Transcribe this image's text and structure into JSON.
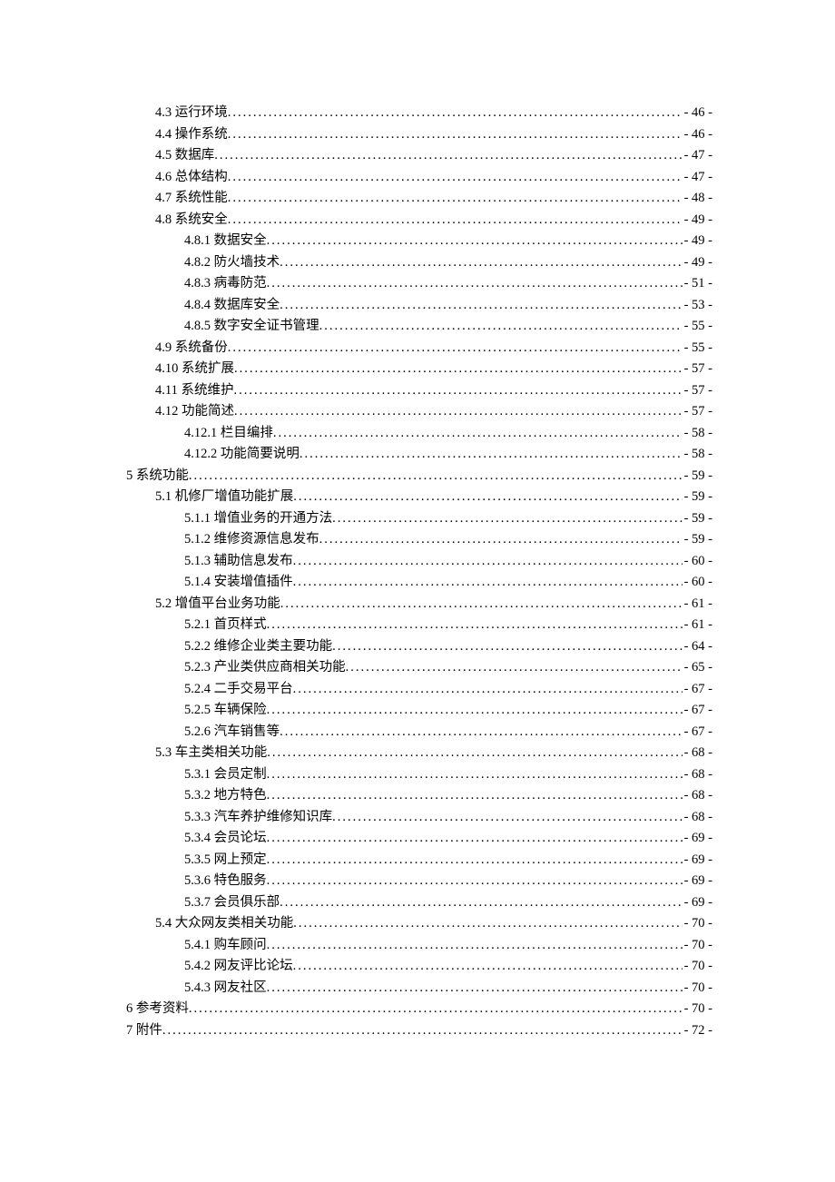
{
  "toc": [
    {
      "level": 1,
      "label": "4.3 运行环境",
      "page": "- 46 -"
    },
    {
      "level": 1,
      "label": "4.4 操作系统",
      "page": "- 46 -"
    },
    {
      "level": 1,
      "label": "4.5 数据库",
      "page": "- 47 -"
    },
    {
      "level": 1,
      "label": "4.6 总体结构",
      "page": "- 47 -"
    },
    {
      "level": 1,
      "label": "4.7  系统性能",
      "page": "- 48 -"
    },
    {
      "level": 1,
      "label": "4.8  系统安全",
      "page": "- 49 -"
    },
    {
      "level": 2,
      "label": "4.8.1  数据安全",
      "page": "- 49 -"
    },
    {
      "level": 2,
      "label": "4.8.2  防火墙技术",
      "page": "- 49 -"
    },
    {
      "level": 2,
      "label": "4.8.3  病毒防范",
      "page": "- 51 -"
    },
    {
      "level": 2,
      "label": "4.8.4  数据库安全",
      "page": "- 53 -"
    },
    {
      "level": 2,
      "label": "4.8.5 数字安全证书管理",
      "page": "- 55 -"
    },
    {
      "level": 1,
      "label": "4.9  系统备份",
      "page": "- 55 -"
    },
    {
      "level": 1,
      "label": "4.10  系统扩展",
      "page": "- 57 -"
    },
    {
      "level": 1,
      "label": "4.11  系统维护",
      "page": "- 57 -"
    },
    {
      "level": 1,
      "label": "4.12 功能简述",
      "page": "- 57 -"
    },
    {
      "level": 2,
      "label": "4.12.1 栏目编排",
      "page": "- 58 -"
    },
    {
      "level": 2,
      "label": "4.12.2 功能简要说明",
      "page": "- 58 -"
    },
    {
      "level": 0,
      "label": "5 系统功能",
      "page": "- 59 -"
    },
    {
      "level": 1,
      "label": "5.1 机修厂增值功能扩展",
      "page": "- 59 -"
    },
    {
      "level": 2,
      "label": "5.1.1 增值业务的开通方法",
      "page": "- 59 -"
    },
    {
      "level": 2,
      "label": "5.1.2 维修资源信息发布",
      "page": "- 59 -"
    },
    {
      "level": 2,
      "label": "5.1.3 辅助信息发布",
      "page": "- 60 -"
    },
    {
      "level": 2,
      "label": "5.1.4 安装增值插件",
      "page": "- 60 -"
    },
    {
      "level": 1,
      "label": "5.2 增值平台业务功能",
      "page": "- 61 -"
    },
    {
      "level": 2,
      "label": "5.2.1 首页样式",
      "page": "- 61 -"
    },
    {
      "level": 2,
      "label": "5.2.2 维修企业类主要功能",
      "page": "- 64 -"
    },
    {
      "level": 2,
      "label": "5.2.3 产业类供应商相关功能",
      "page": "- 65 -"
    },
    {
      "level": 2,
      "label": "5.2.4 二手交易平台",
      "page": "- 67 -"
    },
    {
      "level": 2,
      "label": "5.2.5 车辆保险",
      "page": "- 67 -"
    },
    {
      "level": 2,
      "label": "5.2.6 汽车销售等",
      "page": "- 67 -"
    },
    {
      "level": 1,
      "label": "5.3 车主类相关功能",
      "page": "- 68 -"
    },
    {
      "level": 2,
      "label": "5.3.1 会员定制",
      "page": "- 68 -"
    },
    {
      "level": 2,
      "label": "5.3.2 地方特色",
      "page": "- 68 -"
    },
    {
      "level": 2,
      "label": "5.3.3 汽车养护维修知识库",
      "page": "- 68 -"
    },
    {
      "level": 2,
      "label": "5.3.4 会员论坛",
      "page": "- 69 -"
    },
    {
      "level": 2,
      "label": "5.3.5 网上预定",
      "page": "- 69 -"
    },
    {
      "level": 2,
      "label": "5.3.6 特色服务",
      "page": "- 69 -"
    },
    {
      "level": 2,
      "label": "5.3.7 会员俱乐部",
      "page": "- 69 -"
    },
    {
      "level": 1,
      "label": "5.4 大众网友类相关功能",
      "page": "- 70 -"
    },
    {
      "level": 2,
      "label": "5.4.1 购车顾问",
      "page": "- 70 -"
    },
    {
      "level": 2,
      "label": "5.4.2 网友评比论坛",
      "page": "- 70 -"
    },
    {
      "level": 2,
      "label": "5.4.3 网友社区",
      "page": "- 70 -"
    },
    {
      "level": 0,
      "label": "6 参考资料",
      "page": "- 70 -"
    },
    {
      "level": 0,
      "label": "7 附件",
      "page": "- 72 -"
    }
  ]
}
